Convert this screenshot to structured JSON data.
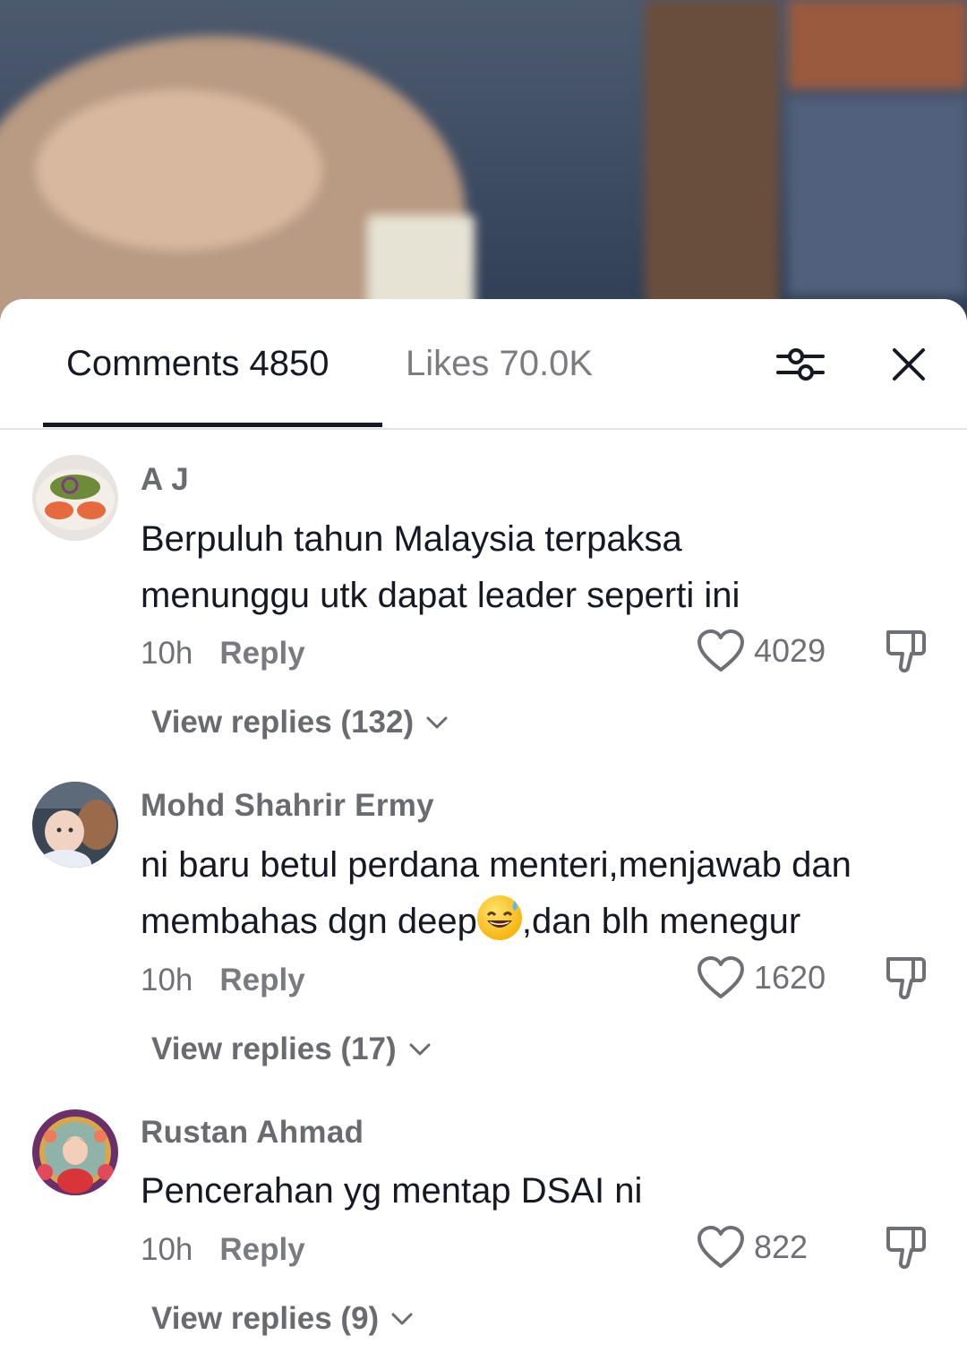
{
  "tabs": {
    "comments_label": "Comments 4850",
    "likes_label": "Likes 70.0K"
  },
  "icons": {
    "filter": "sliders-icon",
    "close": "close-icon",
    "like": "heart-outline-icon",
    "dislike": "thumbs-down-icon",
    "expand": "chevron-down-icon"
  },
  "colors": {
    "text_primary": "#161823",
    "text_secondary": "#6f7075",
    "divider": "#e3e3e3"
  },
  "comments": [
    {
      "username": "A J",
      "text_line1": "Berpuluh tahun Malaysia terpaksa",
      "text_line2": "menunggu utk dapat leader seperti ini",
      "time": "10h",
      "reply_label": "Reply",
      "likes": "4029",
      "view_replies": "View replies (132)"
    },
    {
      "username": "Mohd Shahrir Ermy",
      "text_line1": "ni baru betul perdana menteri,menjawab dan",
      "text_line2_a": "membahas dgn deep",
      "text_line2_b": ",dan blh menegur",
      "time": "10h",
      "reply_label": "Reply",
      "likes": "1620",
      "view_replies": "View replies (17)"
    },
    {
      "username": "Rustan Ahmad",
      "text_line1": "Pencerahan yg mentap DSAI ni",
      "time": "10h",
      "reply_label": "Reply",
      "likes": "822",
      "view_replies": "View replies (9)"
    }
  ]
}
